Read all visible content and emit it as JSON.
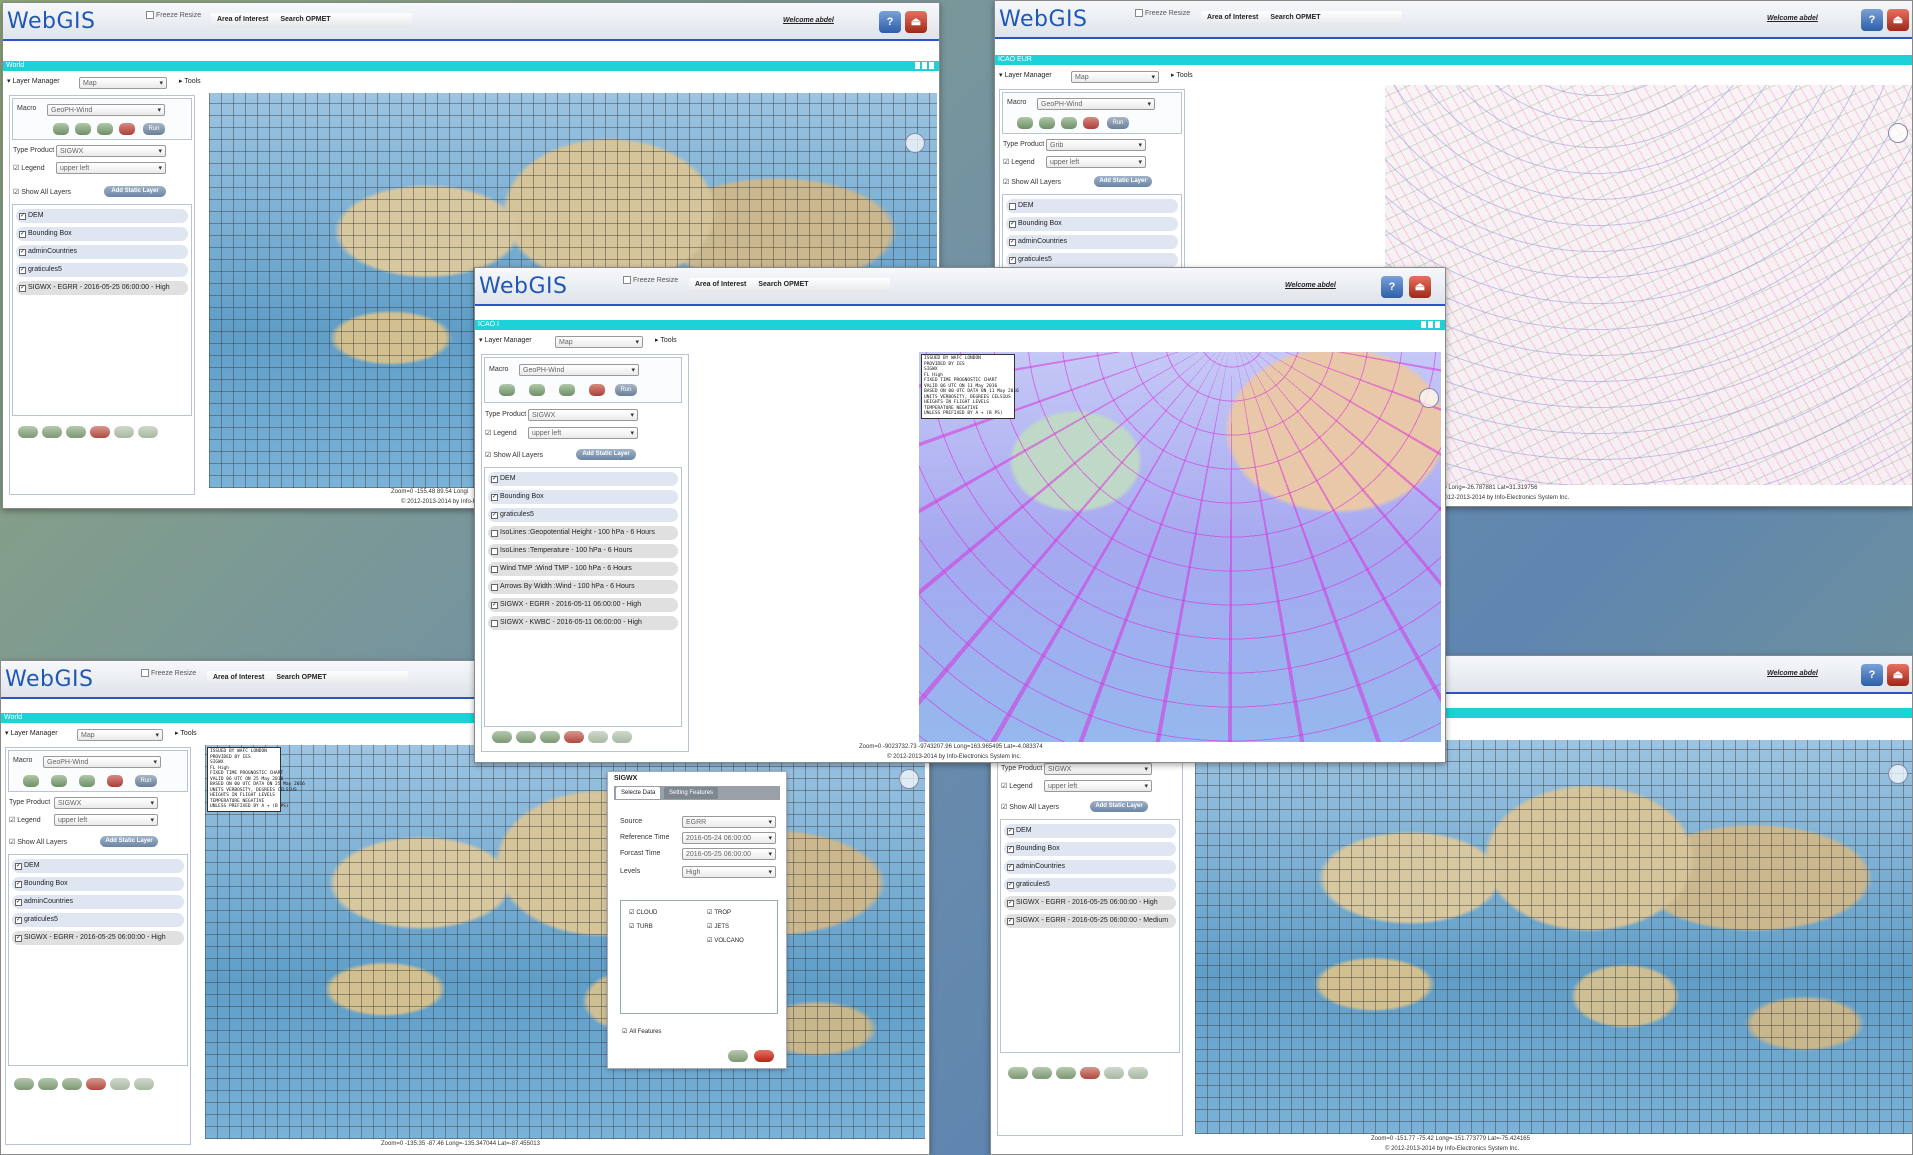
{
  "app": {
    "logo": "WebGIS",
    "freeze_resize": "Freeze Resize",
    "menu_area": "Area of Interest",
    "menu_search": "Search OPMET",
    "welcome": "Welcome abdel",
    "help_icon": "help-icon",
    "exit_icon": "exit-icon",
    "copyright": "© 2012-2013-2014 by Info-Electronics System Inc."
  },
  "panel": {
    "layer_manager": "Layer Manager",
    "map_select": "Map",
    "tools": "Tools",
    "macro_label": "Macro",
    "macro_value": "GeoPH-Wind",
    "run": "Run",
    "type_product_label": "Type Product",
    "legend_label": "Legend",
    "legend_value": "upper left",
    "show_all_layers": "Show All Layers",
    "add_static_layer": "Add Static Layer"
  },
  "windows": {
    "w1": {
      "title": "World",
      "type_product": "SIGWX",
      "layers": [
        "DEM",
        "Bounding Box",
        "adminCountries",
        "graticules5",
        "SIGWX - EGRR - 2016-05-25 06:00:00 - High"
      ],
      "zoom": "Zoom=0 -155.48 89.54 Longi"
    },
    "w2": {
      "title": "ICAO EUR",
      "type_product": "Grib",
      "layers": [
        "DEM",
        "Bounding Box",
        "adminCountries",
        "graticules5"
      ],
      "zoom": "9.60 Long=-26.787881 Lat=31.319756"
    },
    "w3": {
      "title": "ICAO I",
      "type_product": "SIGWX",
      "layers": [
        "DEM",
        "Bounding Box",
        "graticules5",
        "IsoLines :Geopotential Height - 100 hPa - 6 Hours",
        "IsoLines :Temperature - 100 hPa - 6 Hours",
        "Wind TMP :Wind TMP - 100 hPa - 6 Hours",
        "Arrows By Width :Wind - 100 hPa - 6 Hours",
        "SIGWX - EGRR - 2016-05-11 06:00:00 - High",
        "SIGWX - KWBC - 2016-05-11 06:00:00 - High"
      ],
      "zoom": "Zoom=0 -9023732.73 -9743207.96 Long=163.965495 Lat=-4.083374",
      "legend_text": "ISSUED BY WAFC LONDON\nPROVIDED BY IES\nSIGWX\nFL High\nFIXED TIME PROGNOSTIC CHART\nVALID 06 UTC ON 11 May 2016\nBASED ON 00 UTC DATA ON 11 May 2016\nUNITS VERBOSITY, DEGREES CELSIUS\nHEIGHTS IN FLIGHT LEVELS\nTEMPERATURE NEGATIVE\nUNLESS PREFIXED BY A + (B PS)"
    },
    "w4": {
      "title": "World",
      "type_product": "SIGWX",
      "layers": [
        "DEM",
        "Bounding Box",
        "adminCountries",
        "graticules5",
        "SIGWX - EGRR - 2016-05-25 06:00:00 - High"
      ],
      "zoom": "Zoom=0 -135.35 -87.46 Long=-135.347044 Lat=-87.455013",
      "legend_text": "ISSUED BY WAFC LONDON\nPROVIDED BY IES\nSIGWX\nFL High\nFIXED TIME PROGNOSTIC CHART\nVALID 06 UTC ON 25 May 2016\nBASED ON 00 UTC DATA ON 25 May 2016\nUNITS VERBOSITY, DEGREES CELSIUS\nHEIGHTS IN FLIGHT LEVELS\nTEMPERATURE NEGATIVE\nUNLESS PREFIXED BY A + (B PS)"
    },
    "w5": {
      "type_product": "SIGWX",
      "layers": [
        "DEM",
        "Bounding Box",
        "adminCountries",
        "graticules5",
        "SIGWX - EGRR - 2016-05-25 06:00:00 - High",
        "SIGWX - EGRR - 2016-05-25 06:00:00 - Medium"
      ],
      "zoom": "Zoom=0 -151.77 -75.42 Long=-151.773779 Lat=-75.424165"
    }
  },
  "dialog": {
    "title": "SIGWX",
    "tab_select": "Selecte Data",
    "tab_setting": "Setting Features",
    "source_label": "Source",
    "source_value": "EGRR",
    "ref_label": "Reference Time",
    "ref_value": "2016-05-24 06:00:00",
    "fc_label": "Forcast Time",
    "fc_value": "2016-05-25 06:00:00",
    "levels_label": "Levels",
    "levels_value": "High",
    "features": [
      "CLOUD",
      "TROP",
      "TURB",
      "JETS",
      "VOLCANO"
    ],
    "all_features": "All Features"
  },
  "colors": {
    "accent": "#1cd2d6",
    "brand": "#1f57b5",
    "line": "#2a55c8"
  }
}
